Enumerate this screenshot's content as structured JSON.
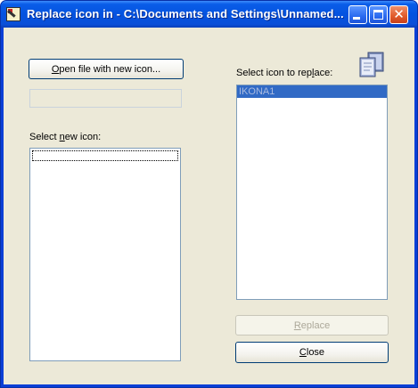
{
  "window": {
    "title": "Replace icon in - C:\\Documents and Settings\\Unnamed...",
    "icons": {
      "app": "icon-editor-pen-icon",
      "minimize": "minimize-icon",
      "maximize": "maximize-icon",
      "close": "close-icon",
      "replace": "copy-pages-icon"
    }
  },
  "left": {
    "open_button": {
      "u": "O",
      "rest": "pen file with new icon..."
    },
    "file_path_value": "",
    "select_new_label": {
      "pre": "Select ",
      "u": "n",
      "post": "ew icon:"
    },
    "new_icon_items": []
  },
  "right": {
    "select_replace_label": {
      "pre": "Select icon to rep",
      "u": "l",
      "post": "ace:"
    },
    "icon_items": [
      "IKONA1"
    ],
    "selected_index": 0,
    "replace_button": {
      "u": "R",
      "rest": "eplace",
      "enabled": false
    },
    "close_button": {
      "u": "C",
      "rest": "lose",
      "enabled": true
    }
  },
  "colors": {
    "title_bar": "#0453e0",
    "selection": "#316ac5",
    "dialog_bg": "#ece9d8",
    "list_border": "#7f9db9"
  }
}
